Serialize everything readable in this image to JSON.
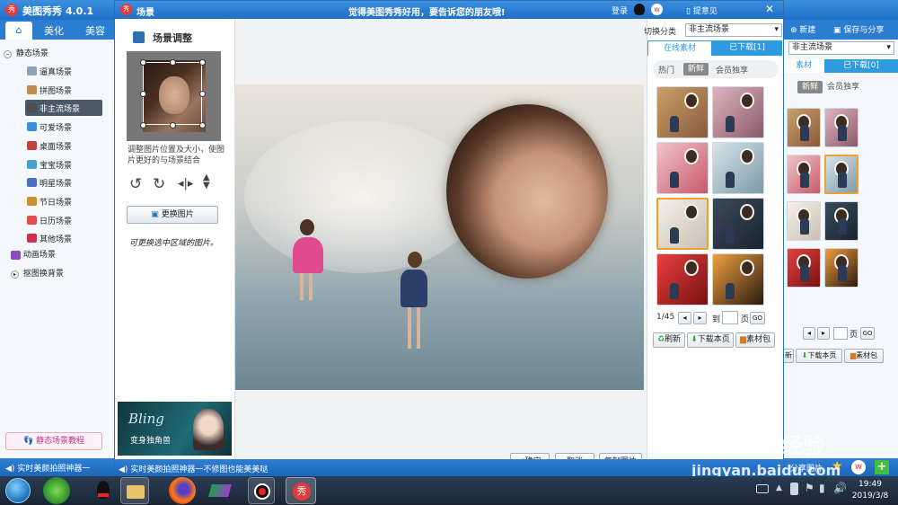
{
  "main_window": {
    "title": "美图秀秀 4.0.1",
    "tabs": [
      "主",
      "美化",
      "美容"
    ],
    "right_tabs": [
      "新建",
      "保存与分享"
    ],
    "right_dropdown": "非主流场景",
    "right_pager_label": "页",
    "right_go": "GO",
    "right_btn_download": "下载本页",
    "right_btn_pack": "素材包",
    "right_btn_refresh": "新",
    "right_tab_online": "素材",
    "right_tab_downloaded": "已下载[0]",
    "right_filters": [
      "新鲜",
      "会员独享"
    ],
    "share_label": "分享图片",
    "status_ticker": "实时美颜拍照神器一"
  },
  "sidebar": {
    "groups": [
      {
        "label": "静态场景",
        "items": [
          "逼真场景",
          "拼图场景",
          "非主流场景",
          "可爱场景",
          "桌面场景",
          "宝宝场景",
          "明星场景",
          "节日场景",
          "日历场景",
          "其他场景"
        ]
      },
      {
        "label": "动画场景"
      },
      {
        "label": "抠图换背景"
      }
    ],
    "selected": "非主流场景",
    "tutorial": "静态场景教程"
  },
  "dialog": {
    "title": "场景",
    "banner": "觉得美图秀秀好用，要告诉您的朋友哦!",
    "login": "登录",
    "feedback": "提意见",
    "panel_title": "场景调整",
    "hint": "调整图片位置及大小，使图片更好的与场景结合",
    "replace_button": "更换图片",
    "handwritten_note": "可更换选中区域的图片。",
    "ad_brand": "Bling",
    "ad_caption": "变身独角兽",
    "ok_button": "确定",
    "cancel_button": "取消",
    "copy_button": "复制图片",
    "ticker": "实时美颜拍照神器一不修图也能美美哒",
    "category_label": "切换分类",
    "category_value": "非主流场景",
    "tab_online": "在线素材",
    "tab_downloaded": "已下载[1]",
    "filters": [
      "热门",
      "新鲜",
      "会员独享"
    ],
    "active_filter": "新鲜",
    "pager": {
      "text": "1/45",
      "goto_label": "到",
      "page_label": "页",
      "go": "GO"
    },
    "actions": [
      "刷新",
      "下载本页",
      "素材包"
    ]
  },
  "taskbar": {
    "time": "19:49",
    "date": "2019/3/8",
    "app_icons": [
      "start-orb",
      "360-browser",
      "qq",
      "file-explorer",
      "firefox",
      "video-player",
      "screen-recorder",
      "meitu"
    ]
  },
  "watermark": {
    "line1": "Bai",
    "line2": "经验",
    "url": "jingyan.baidu.com"
  },
  "colors": {
    "accent": "#2e9be0",
    "header": "#1e6fc7",
    "selected_item": "#4a5a68"
  }
}
